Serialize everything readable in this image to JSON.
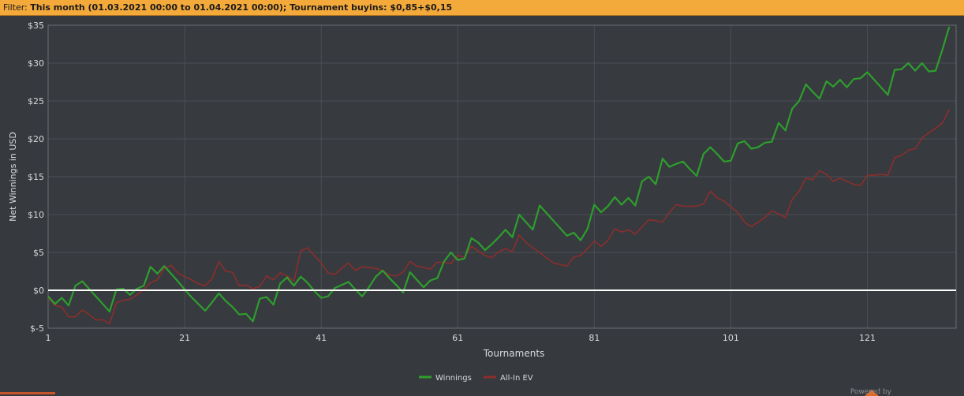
{
  "filter": {
    "label": "Filter:",
    "text": "This month (01.03.2021 00:00 to 01.04.2021 00:00); Tournament buyins: $0,85+$0,15"
  },
  "footer": {
    "powered": "Powered by"
  },
  "chart_data": {
    "type": "line",
    "xlabel": "Tournaments",
    "ylabel": "Net Winnings in USD",
    "xlim": [
      1,
      134
    ],
    "ylim": [
      -5,
      35
    ],
    "xticks": [
      1,
      21,
      41,
      61,
      81,
      101,
      121
    ],
    "yticks": [
      -5,
      0,
      5,
      10,
      15,
      20,
      25,
      30,
      35
    ],
    "ytick_labels": [
      "$-5",
      "$0",
      "$5",
      "$10",
      "$15",
      "$20",
      "$25",
      "$30",
      "$35"
    ],
    "grid": true,
    "legend": "bottom-center",
    "zero_line": 0,
    "series": [
      {
        "name": "Winnings",
        "color": "#2e9e2e",
        "points": [
          [
            1,
            -0.8
          ],
          [
            2,
            -1.8
          ],
          [
            3,
            -1
          ],
          [
            4,
            -2
          ],
          [
            5,
            0.6
          ],
          [
            6,
            1.2
          ],
          [
            7,
            0.2
          ],
          [
            8,
            -0.8
          ],
          [
            9,
            -1.8
          ],
          [
            10,
            -2.8
          ],
          [
            11,
            0.1
          ],
          [
            12,
            0.2
          ],
          [
            13,
            -0.6
          ],
          [
            14,
            0.2
          ],
          [
            15,
            0.6
          ],
          [
            16,
            3.1
          ],
          [
            17,
            2.2
          ],
          [
            18,
            3.2
          ],
          [
            19,
            2.2
          ],
          [
            20,
            1.2
          ],
          [
            21,
            0.1
          ],
          [
            22,
            -0.9
          ],
          [
            23,
            -1.8
          ],
          [
            24,
            -2.7
          ],
          [
            25,
            -1.6
          ],
          [
            26,
            -0.4
          ],
          [
            27,
            -1.4
          ],
          [
            28,
            -2.2
          ],
          [
            29,
            -3.2
          ],
          [
            30,
            -3.1
          ],
          [
            31,
            -4.1
          ],
          [
            32,
            -1.1
          ],
          [
            33,
            -0.9
          ],
          [
            34,
            -1.9
          ],
          [
            35,
            0.9
          ],
          [
            36,
            1.7
          ],
          [
            37,
            0.6
          ],
          [
            38,
            1.8
          ],
          [
            39,
            1
          ],
          [
            40,
            -0.1
          ],
          [
            41,
            -1
          ],
          [
            42,
            -0.8
          ],
          [
            43,
            0.3
          ],
          [
            44,
            0.7
          ],
          [
            45,
            1.1
          ],
          [
            46,
            0.1
          ],
          [
            47,
            -0.8
          ],
          [
            48,
            0.4
          ],
          [
            49,
            1.8
          ],
          [
            50,
            2.6
          ],
          [
            51,
            1.6
          ],
          [
            52,
            0.7
          ],
          [
            53,
            -0.3
          ],
          [
            54,
            2.4
          ],
          [
            55,
            1.4
          ],
          [
            56,
            0.4
          ],
          [
            57,
            1.3
          ],
          [
            58,
            1.6
          ],
          [
            59,
            3.8
          ],
          [
            60,
            5
          ],
          [
            61,
            4
          ],
          [
            62,
            4.2
          ],
          [
            63,
            6.9
          ],
          [
            64,
            6.3
          ],
          [
            65,
            5.3
          ],
          [
            66,
            6.1
          ],
          [
            67,
            7
          ],
          [
            68,
            8
          ],
          [
            69,
            7
          ],
          [
            70,
            10
          ],
          [
            71,
            9
          ],
          [
            72,
            8
          ],
          [
            73,
            11.2
          ],
          [
            74,
            10.2
          ],
          [
            75,
            9.2
          ],
          [
            76,
            8.2
          ],
          [
            77,
            7.2
          ],
          [
            78,
            7.6
          ],
          [
            79,
            6.6
          ],
          [
            80,
            8.1
          ],
          [
            81,
            11.3
          ],
          [
            82,
            10.3
          ],
          [
            83,
            11.1
          ],
          [
            84,
            12.3
          ],
          [
            85,
            11.3
          ],
          [
            86,
            12.2
          ],
          [
            87,
            11.2
          ],
          [
            88,
            14.4
          ],
          [
            89,
            15
          ],
          [
            90,
            14
          ],
          [
            91,
            17.4
          ],
          [
            92,
            16.3
          ],
          [
            93,
            16.7
          ],
          [
            94,
            17
          ],
          [
            95,
            16
          ],
          [
            96,
            15.1
          ],
          [
            97,
            18
          ],
          [
            98,
            18.9
          ],
          [
            99,
            18
          ],
          [
            100,
            17
          ],
          [
            101,
            17.1
          ],
          [
            102,
            19.4
          ],
          [
            103,
            19.7
          ],
          [
            104,
            18.7
          ],
          [
            105,
            18.9
          ],
          [
            106,
            19.5
          ],
          [
            107,
            19.6
          ],
          [
            108,
            22.1
          ],
          [
            109,
            21.1
          ],
          [
            110,
            24
          ],
          [
            111,
            25
          ],
          [
            112,
            27.2
          ],
          [
            113,
            26.2
          ],
          [
            114,
            25.3
          ],
          [
            115,
            27.6
          ],
          [
            116,
            26.9
          ],
          [
            117,
            27.8
          ],
          [
            118,
            26.8
          ],
          [
            119,
            27.9
          ],
          [
            120,
            28
          ],
          [
            121,
            28.8
          ],
          [
            122,
            27.8
          ],
          [
            123,
            26.8
          ],
          [
            124,
            25.8
          ],
          [
            125,
            29.1
          ],
          [
            126,
            29.2
          ],
          [
            127,
            30
          ],
          [
            128,
            29
          ],
          [
            129,
            30
          ],
          [
            130,
            28.9
          ],
          [
            131,
            29
          ],
          [
            132,
            31.8
          ],
          [
            133,
            34.8
          ]
        ]
      },
      {
        "name": "All-In EV",
        "color": "#8c2e2e",
        "points": [
          [
            1,
            -1
          ],
          [
            2,
            -2
          ],
          [
            3,
            -2.2
          ],
          [
            4,
            -3.5
          ],
          [
            5,
            -3.5
          ],
          [
            6,
            -2.6
          ],
          [
            7,
            -3.2
          ],
          [
            8,
            -3.9
          ],
          [
            9,
            -3.9
          ],
          [
            10,
            -4.4
          ],
          [
            11,
            -1.7
          ],
          [
            12,
            -1.3
          ],
          [
            13,
            -1.2
          ],
          [
            14,
            -0.6
          ],
          [
            15,
            0.1
          ],
          [
            16,
            1
          ],
          [
            17,
            1.4
          ],
          [
            18,
            2.9
          ],
          [
            19,
            3.3
          ],
          [
            20,
            2.3
          ],
          [
            21,
            1.8
          ],
          [
            22,
            1.4
          ],
          [
            23,
            0.9
          ],
          [
            24,
            0.6
          ],
          [
            25,
            1.5
          ],
          [
            26,
            3.8
          ],
          [
            27,
            2.5
          ],
          [
            28,
            2.4
          ],
          [
            29,
            0.6
          ],
          [
            30,
            0.7
          ],
          [
            31,
            0.2
          ],
          [
            32,
            0.5
          ],
          [
            33,
            1.9
          ],
          [
            34,
            1.4
          ],
          [
            35,
            2.3
          ],
          [
            36,
            1.9
          ],
          [
            37,
            1.2
          ],
          [
            38,
            5.2
          ],
          [
            39,
            5.6
          ],
          [
            40,
            4.6
          ],
          [
            41,
            3.6
          ],
          [
            42,
            2.3
          ],
          [
            43,
            2.1
          ],
          [
            44,
            2.9
          ],
          [
            45,
            3.6
          ],
          [
            46,
            2.6
          ],
          [
            47,
            3.1
          ],
          [
            48,
            3
          ],
          [
            49,
            2.9
          ],
          [
            50,
            2.6
          ],
          [
            51,
            2
          ],
          [
            52,
            1.9
          ],
          [
            53,
            2.4
          ],
          [
            54,
            3.8
          ],
          [
            55,
            3.2
          ],
          [
            56,
            3
          ],
          [
            57,
            2.8
          ],
          [
            58,
            3.7
          ],
          [
            59,
            3.7
          ],
          [
            60,
            3.5
          ],
          [
            61,
            4.6
          ],
          [
            62,
            4.4
          ],
          [
            63,
            5.8
          ],
          [
            64,
            5.2
          ],
          [
            65,
            4.6
          ],
          [
            66,
            4.3
          ],
          [
            67,
            5.1
          ],
          [
            68,
            5.5
          ],
          [
            69,
            5.1
          ],
          [
            70,
            7.3
          ],
          [
            71,
            6.3
          ],
          [
            72,
            5.6
          ],
          [
            73,
            5
          ],
          [
            74,
            4.3
          ],
          [
            75,
            3.6
          ],
          [
            76,
            3.4
          ],
          [
            77,
            3.2
          ],
          [
            78,
            4.4
          ],
          [
            79,
            4.6
          ],
          [
            80,
            5.5
          ],
          [
            81,
            6.5
          ],
          [
            82,
            5.8
          ],
          [
            83,
            6.6
          ],
          [
            84,
            8.1
          ],
          [
            85,
            7.7
          ],
          [
            86,
            8
          ],
          [
            87,
            7.4
          ],
          [
            88,
            8.4
          ],
          [
            89,
            9.3
          ],
          [
            90,
            9.2
          ],
          [
            91,
            9
          ],
          [
            92,
            10.3
          ],
          [
            93,
            11.3
          ],
          [
            94,
            11.1
          ],
          [
            95,
            11.1
          ],
          [
            96,
            11.1
          ],
          [
            97,
            11.4
          ],
          [
            98,
            13.1
          ],
          [
            99,
            12.2
          ],
          [
            100,
            11.8
          ],
          [
            101,
            11
          ],
          [
            102,
            10.3
          ],
          [
            103,
            9
          ],
          [
            104,
            8.4
          ],
          [
            105,
            9
          ],
          [
            106,
            9.6
          ],
          [
            107,
            10.5
          ],
          [
            108,
            10.1
          ],
          [
            109,
            9.6
          ],
          [
            110,
            12
          ],
          [
            111,
            13.1
          ],
          [
            112,
            14.8
          ],
          [
            113,
            14.6
          ],
          [
            114,
            15.8
          ],
          [
            115,
            15.3
          ],
          [
            116,
            14.4
          ],
          [
            117,
            14.8
          ],
          [
            118,
            14.4
          ],
          [
            119,
            14
          ],
          [
            120,
            13.8
          ],
          [
            121,
            15.2
          ],
          [
            122,
            15.2
          ],
          [
            123,
            15.3
          ],
          [
            124,
            15.2
          ],
          [
            125,
            17.5
          ],
          [
            126,
            17.8
          ],
          [
            127,
            18.5
          ],
          [
            128,
            18.7
          ],
          [
            129,
            20.1
          ],
          [
            130,
            20.8
          ],
          [
            131,
            21.4
          ],
          [
            132,
            22.1
          ],
          [
            133,
            23.9
          ]
        ]
      }
    ]
  }
}
